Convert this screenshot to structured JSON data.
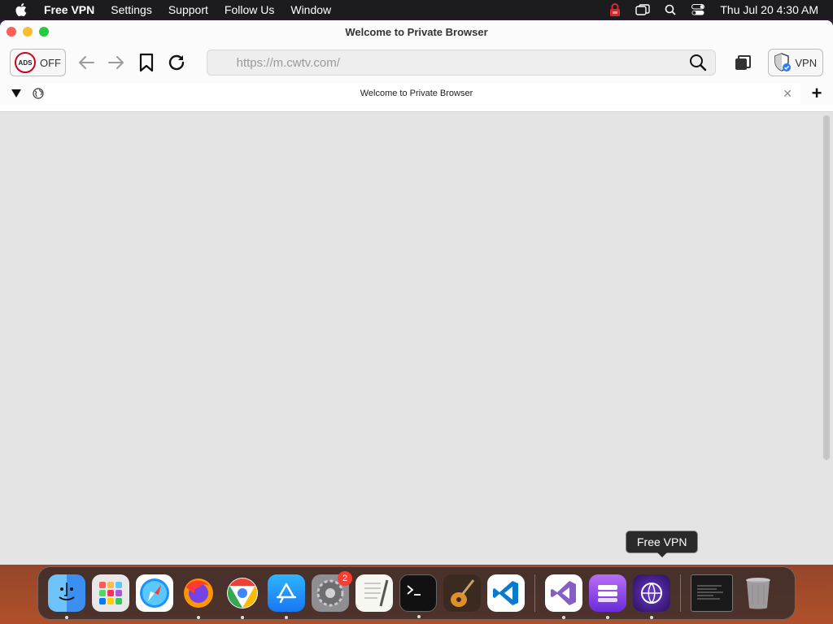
{
  "menubar": {
    "apple_icon": "apple-icon",
    "items": [
      "Free VPN",
      "Settings",
      "Support",
      "Follow Us",
      "Window"
    ],
    "clock": "Thu Jul 20  4:30 AM",
    "status_icons": [
      "lock-icon",
      "window-switch-icon",
      "spotlight-search-icon",
      "control-center-icon"
    ]
  },
  "window": {
    "title": "Welcome to Private Browser"
  },
  "toolbar": {
    "ads_badge": "ADS",
    "ads_state": "OFF",
    "url_value": "https://m.cwtv.com/",
    "vpn_label": "VPN"
  },
  "tab": {
    "title": "Welcome to Private Browser"
  },
  "dock": {
    "apps": [
      {
        "name": "Finder",
        "icon": "finder-icon"
      },
      {
        "name": "Launchpad",
        "icon": "launchpad-icon"
      },
      {
        "name": "Safari",
        "icon": "safari-icon"
      },
      {
        "name": "Firefox",
        "icon": "firefox-icon"
      },
      {
        "name": "Chrome",
        "icon": "chrome-icon"
      },
      {
        "name": "App Store",
        "icon": "app-store-icon"
      },
      {
        "name": "System Preferences",
        "icon": "system-preferences-icon",
        "badge": "2"
      },
      {
        "name": "TextEdit",
        "icon": "textedit-icon"
      },
      {
        "name": "Terminal",
        "icon": "terminal-icon"
      },
      {
        "name": "GarageBand",
        "icon": "garageband-icon"
      },
      {
        "name": "Visual Studio Code",
        "icon": "vscode-icon"
      },
      {
        "name": "Visual Studio",
        "icon": "visual-studio-icon"
      },
      {
        "name": "Storage",
        "icon": "storage-icon"
      },
      {
        "name": "Free VPN",
        "icon": "free-vpn-icon"
      }
    ],
    "tooltip": "Free VPN"
  },
  "colors": {
    "menubar_bg": "#1c1c1e",
    "content_bg": "#e4e4e4",
    "ads_ring": "#d0021b",
    "vpn_check": "#2f7bf6"
  }
}
